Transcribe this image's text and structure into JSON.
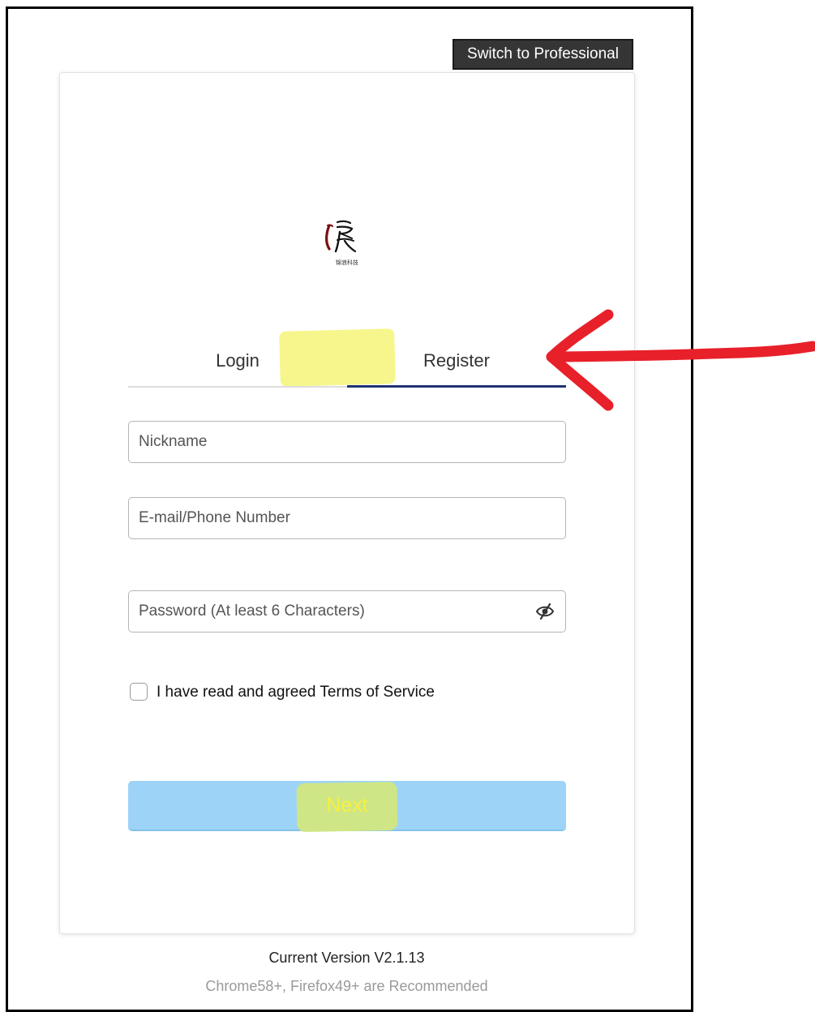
{
  "header": {
    "switch_label": "Switch to Professional"
  },
  "logo": {
    "glyph": "浪",
    "caption": "锦浪科技"
  },
  "tabs": [
    {
      "label": "Login",
      "active": false
    },
    {
      "label": "Register",
      "active": true
    }
  ],
  "form": {
    "nickname_placeholder": "Nickname",
    "email_placeholder": "E-mail/Phone Number",
    "password_placeholder": "Password (At least 6 Characters)",
    "password_toggle_icon": "eye-slash-icon",
    "terms_label": "I have read and agreed Terms of Service",
    "terms_checked": false,
    "next_label": "Next"
  },
  "footer": {
    "version": "Current Version V2.1.13",
    "recommend": "Chrome58+, Firefox49+ are Recommended"
  },
  "colors": {
    "accent_underline": "#1e3373",
    "next_button": "#9dd3f7",
    "highlighter": "#f6f686",
    "annotation_arrow": "#e8202a"
  }
}
